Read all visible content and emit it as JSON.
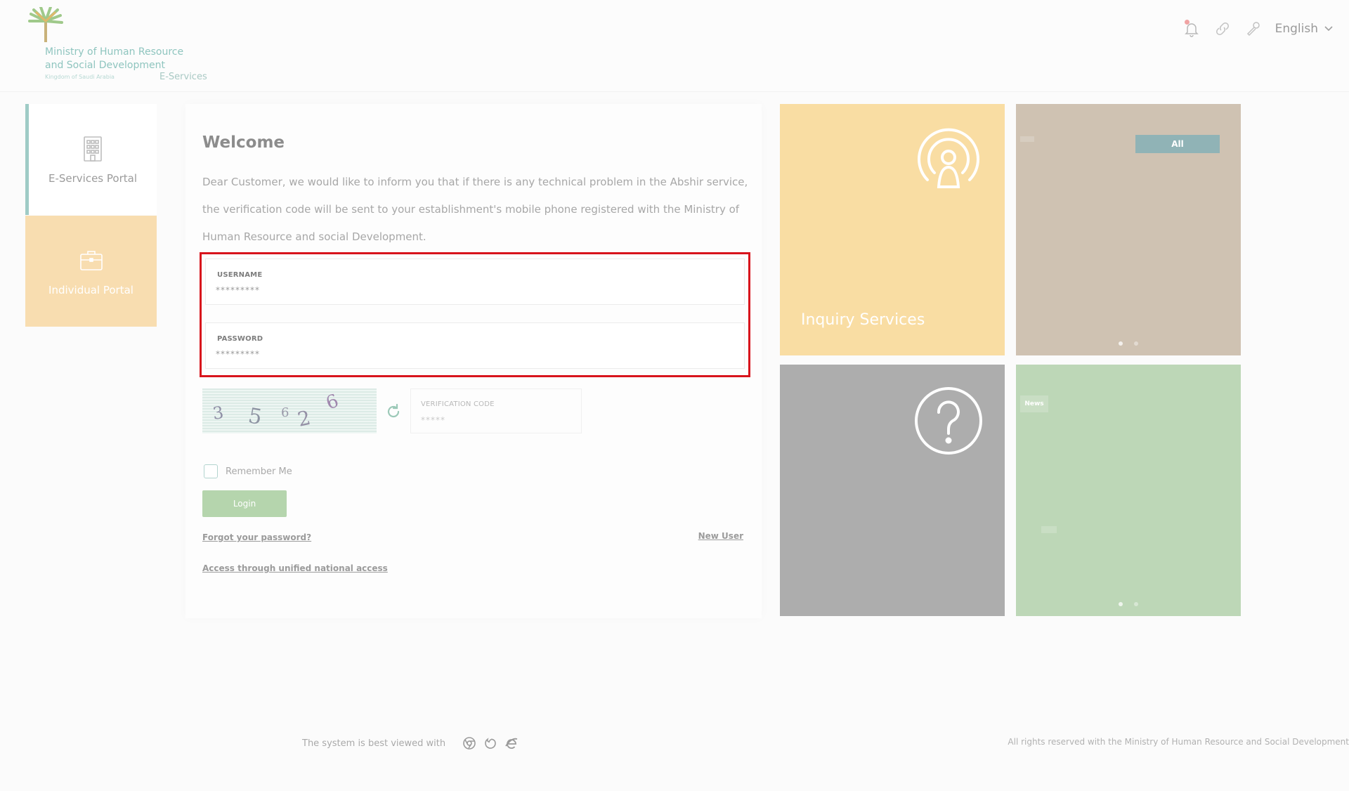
{
  "header": {
    "logo": {
      "line1": "Ministry of Human Resource",
      "line2": "and Social Development",
      "line3": "Kingdom of Saudi Arabia",
      "subtitle": "E-Services"
    },
    "icons": [
      "bell-icon",
      "link-icon",
      "wrench-icon"
    ],
    "language": "English"
  },
  "sidebar": {
    "items": [
      {
        "label": "E-Services Portal",
        "icon": "building-icon",
        "active": true
      },
      {
        "label": "Individual Portal",
        "icon": "briefcase-icon",
        "active": false
      }
    ]
  },
  "login": {
    "title": "Welcome",
    "notice": "Dear Customer, we would like to inform you that if there is any technical problem in the Abshir service, the verification code will be sent to your establishment's mobile phone registered with the Ministry of Human Resource and social Development.",
    "username": {
      "label": "USERNAME",
      "placeholder": "*********",
      "value": ""
    },
    "password": {
      "label": "PASSWORD",
      "placeholder": "*********",
      "value": ""
    },
    "captcha": {
      "digits": [
        "3",
        "5",
        "6",
        "2",
        "6"
      ]
    },
    "verification": {
      "label": "VERIFICATION CODE",
      "placeholder": "*****",
      "value": ""
    },
    "remember_label": "Remember Me",
    "remember_checked": false,
    "login_label": "Login",
    "forgot_label": "Forgot your password?",
    "new_user_label": "New User",
    "unified_label": "Access through unified national access"
  },
  "tiles": {
    "inquiry": {
      "label": "Inquiry Services",
      "color": "#f9dda3"
    },
    "announcements": {
      "badge": "All",
      "color": "#cfc2b2"
    },
    "help": {
      "color": "#adadad"
    },
    "news": {
      "badge": "News",
      "color": "#bdd7b7"
    }
  },
  "footer": {
    "best_viewed": "The system is best viewed with",
    "browsers": [
      "chrome-icon",
      "firefox-icon",
      "ie-icon"
    ],
    "rights": "All rights reserved with the Ministry of Human Resource and Social Development"
  },
  "colors": {
    "accent_teal": "#9fcbc6",
    "highlight_red": "#d8141c",
    "login_green": "#b5d5ad"
  }
}
